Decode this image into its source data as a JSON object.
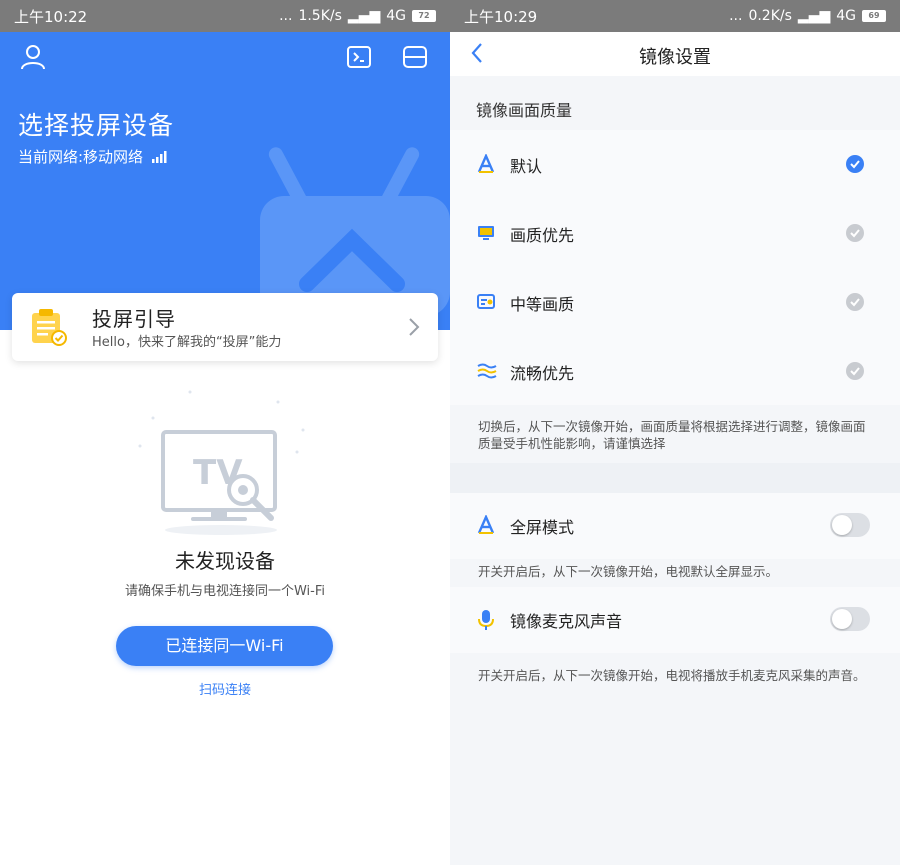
{
  "left": {
    "statusbar": {
      "time": "上午10:22",
      "dots": "...",
      "speed": "1.5K/s",
      "network": "4G",
      "battery": "72"
    },
    "header": {
      "title": "选择投屏设备",
      "network_label": "当前网络:移动网络"
    },
    "guide": {
      "title": "投屏引导",
      "subtitle": "Hello，快来了解我的“投屏”能力"
    },
    "empty": {
      "illustration_text": "TV",
      "title": "未发现设备",
      "subtitle": "请确保手机与电视连接同一个Wi-Fi"
    },
    "connect_button_label": "已连接同一Wi-Fi",
    "scan_link_label": "扫码连接",
    "colors": {
      "primary": "#3a80f5"
    },
    "icons": [
      "user-icon",
      "terminal-icon",
      "scan-icon",
      "tv-icon",
      "clipboard-icon",
      "chevron-right-icon"
    ]
  },
  "right": {
    "statusbar": {
      "time": "上午10:29",
      "dots": "...",
      "speed": "0.2K/s",
      "network": "4G",
      "battery": "69"
    },
    "nav": {
      "title": "镜像设置"
    },
    "quality": {
      "header": "镜像画面质量",
      "options": [
        {
          "label": "默认",
          "selected": true,
          "icon": "default-quality-icon"
        },
        {
          "label": "画质优先",
          "selected": false,
          "icon": "monitor-icon"
        },
        {
          "label": "中等画质",
          "selected": false,
          "icon": "medium-quality-icon"
        },
        {
          "label": "流畅优先",
          "selected": false,
          "icon": "wave-icon"
        }
      ],
      "note": "切换后，从下一次镜像开始，画面质量将根据选择进行调整，镜像画面质量受手机性能影响，请谨慎选择"
    },
    "fullscreen": {
      "label": "全屏模式",
      "enabled": false,
      "note": "开关开启后，从下一次镜像开始，电视默认全屏显示。"
    },
    "mic": {
      "label": "镜像麦克风声音",
      "enabled": false,
      "note": "开关开启后，从下一次镜像开始，电视将播放手机麦克风采集的声音。"
    },
    "colors": {
      "check_active": "#3a80f5",
      "check_inactive": "#c8cbd0"
    }
  }
}
